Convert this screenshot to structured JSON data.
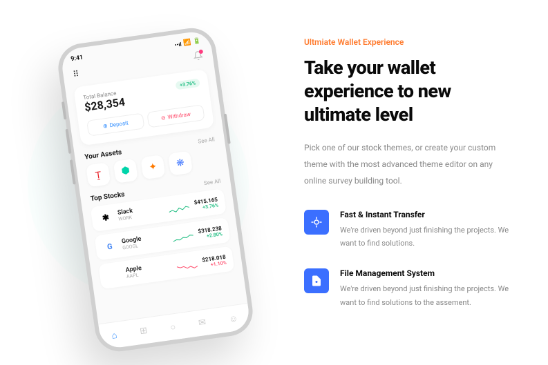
{
  "phone": {
    "time": "9:41",
    "balance_label": "Total Balance",
    "balance_amount": "$28,354",
    "balance_change": "+3.76%",
    "deposit_label": "Deposit",
    "withdraw_label": "Withdraw",
    "assets_title": "Your Assets",
    "see_all": "See All",
    "stocks_title": "Top Stocks",
    "stocks": [
      {
        "name": "Slack",
        "ticker": "WORK",
        "price": "$415.165",
        "change": "+3.76%",
        "dir": "pos"
      },
      {
        "name": "Google",
        "ticker": "GOOGL",
        "price": "$318.238",
        "change": "+2.80%",
        "dir": "pos"
      },
      {
        "name": "Apple",
        "ticker": "AAPL",
        "price": "$218.018",
        "change": "+1.10%",
        "dir": "neg"
      }
    ]
  },
  "content": {
    "eyebrow": "Ultmiate Wallet Experience",
    "headline": "Take your wallet experience to new ultimate level",
    "subhead": "Pick one of our stock themes, or create your custom theme with the most advanced theme editor on any online survey building tool.",
    "features": [
      {
        "title": "Fast & Instant Transfer",
        "desc": "We're driven beyond just finishing the projects. We want to find solutions."
      },
      {
        "title": "File Management System",
        "desc": "We're driven beyond just finishing the projects. We want to find solutions to the assement."
      }
    ]
  }
}
